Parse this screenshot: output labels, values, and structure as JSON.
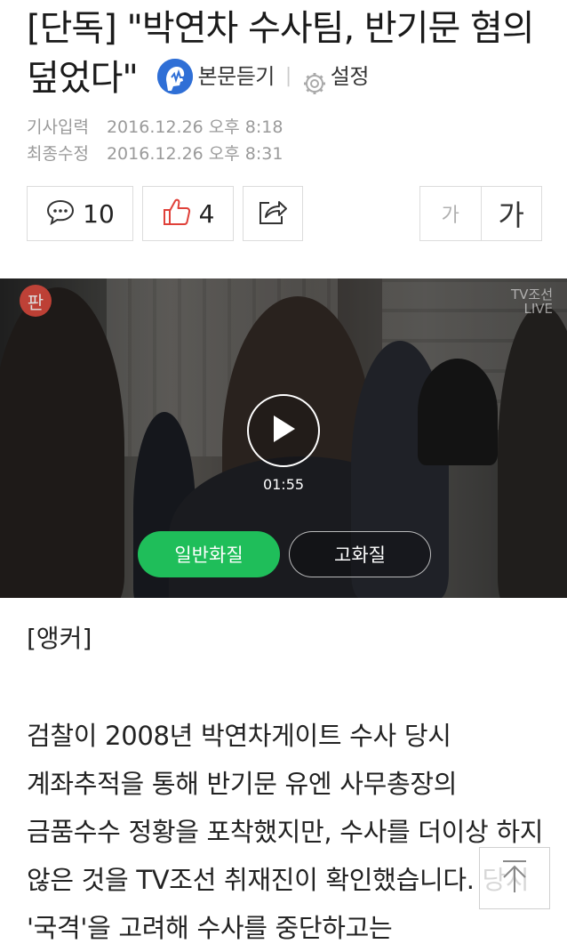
{
  "article": {
    "title": "[단독] \"박연차 수사팀, 반기문 혐의 덮었다\"",
    "tts_label": "본문듣기",
    "settings_label": "설정",
    "input_label": "기사입력",
    "input_time": "2016.12.26 오후 8:18",
    "modified_label": "최종수정",
    "modified_time": "2016.12.26 오후 8:31"
  },
  "actions": {
    "comment_count": "10",
    "like_count": "4",
    "font_small": "가",
    "font_large": "가"
  },
  "video": {
    "badge": "판",
    "channel_logo": "TV조선",
    "channel_logo_sub": "LIVE",
    "duration": "01:55",
    "quality_normal": "일반화질",
    "quality_high": "고화질"
  },
  "body": {
    "anchor_label": "[앵커]",
    "paragraph": "검찰이 2008년 박연차게이트 수사 당시 계좌추적을 통해 반기문 유엔 사무총장의 금품수수 정황을 포착했지만, 수사를 더이상 하지 않은 것을 TV조선 취재진이 확인했습니다. 당시 '국격'을 고려해 수사를 중단하고는"
  },
  "colors": {
    "accent_green": "#1fbe5a",
    "like_red": "#e0413a",
    "tts_blue": "#2f6fd6"
  }
}
